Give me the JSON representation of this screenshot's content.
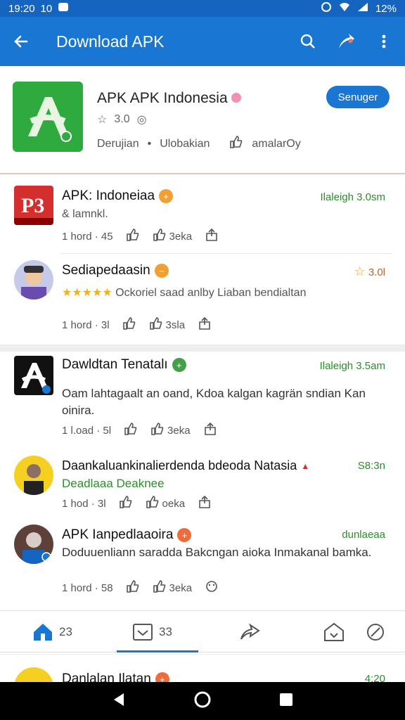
{
  "status_bar": {
    "time": "19:20",
    "extra": "10",
    "battery": "12%"
  },
  "app_bar": {
    "title": "Download APK"
  },
  "header": {
    "app_name": "APK APK Indonesia",
    "rating": "3.0",
    "meta_1": "Derujian",
    "meta_sep": "•",
    "meta_2": "Ulobakian",
    "meta_3": "amalarOy",
    "follow_label": "Senuger"
  },
  "posts": [
    {
      "name": "APK: Indoneiaa",
      "sub": "& lamnkl.",
      "time": "Ilaleigh 3.0sm",
      "stat_a": "1 hord · 45",
      "stat_b": "3eka"
    },
    {
      "name": "Sediapedaasin",
      "rating_text": "Ockoriel saad anlby Liaban bendialtan",
      "time": "3.0l",
      "stat_a": "1 hord · 3l",
      "stat_b": "3sla"
    },
    {
      "name": "Dawldtan Tenatalı",
      "body": "Oam lahtagaalt an oand, Kdoa kalgan kagrän sndian Kan oinira.",
      "time": "Ilaleigh 3.5am",
      "stat_a": "1 l.oad · 5l",
      "stat_b": "3eka"
    },
    {
      "name": "Daankaluankinalierdenda bdeoda Natasia",
      "sub": "Deadlaaa Deaknee",
      "time": "S8:3n",
      "stat_a": "1 hod · 3l",
      "stat_b": "oeka"
    },
    {
      "name": "APK Ianpedlaaoira",
      "body": "Doduuenliann saradda Bakcngan aioka Inmakanal bamka.",
      "time": "dunlaeaa",
      "stat_a": "1 hord · 58",
      "stat_b": "3eka"
    }
  ],
  "bottom_tabs": {
    "tab1_count": "23",
    "tab2_count": "33"
  },
  "peek": {
    "name": "Danlalan Ilatan",
    "time": "4:20"
  },
  "colors": {
    "primary": "#1976d2",
    "green": "#2e8b2e",
    "orange": "#f0a030"
  }
}
